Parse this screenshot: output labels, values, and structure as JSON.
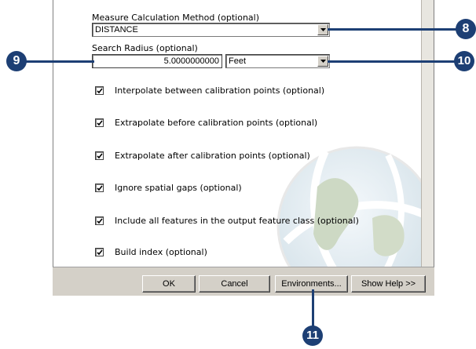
{
  "form": {
    "measure_method_label": "Measure Calculation Method (optional)",
    "measure_method_value": "DISTANCE",
    "search_radius_label": "Search Radius (optional)",
    "search_radius_value": "5.0000000000",
    "search_radius_unit": "Feet",
    "checkboxes": [
      {
        "label": "Interpolate between calibration points (optional)",
        "checked": true
      },
      {
        "label": "Extrapolate before calibration points (optional)",
        "checked": true
      },
      {
        "label": "Extrapolate after calibration points (optional)",
        "checked": true
      },
      {
        "label": "Ignore spatial gaps (optional)",
        "checked": true
      },
      {
        "label": "Include all features in the output feature class (optional)",
        "checked": true
      },
      {
        "label": "Build index (optional)",
        "checked": true
      }
    ]
  },
  "buttons": {
    "ok": "OK",
    "cancel": "Cancel",
    "environments": "Environments...",
    "show_help": "Show Help >>"
  },
  "callouts": {
    "c8": "8",
    "c9": "9",
    "c10": "10",
    "c11": "11"
  },
  "colors": {
    "callout": "#1d3f74",
    "dialog_face": "#d4d0c8"
  },
  "icons": {
    "dropdown": "chevron-down-icon",
    "check": "check-icon",
    "watermark": "globe-icon"
  }
}
